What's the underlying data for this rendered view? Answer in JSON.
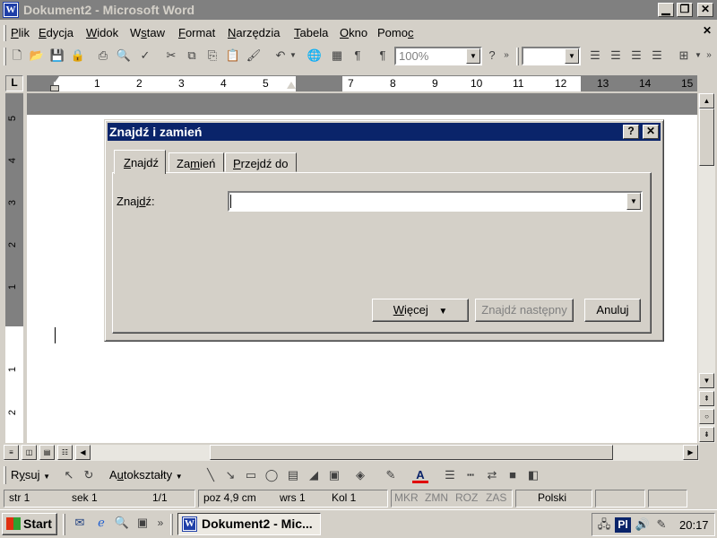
{
  "window": {
    "title": "Dokument2 - Microsoft Word",
    "app_icon_letter": "W"
  },
  "menu": {
    "items": [
      {
        "pre": "",
        "u": "P",
        "post": "lik"
      },
      {
        "pre": "",
        "u": "E",
        "post": "dycja"
      },
      {
        "pre": "",
        "u": "W",
        "post": "idok"
      },
      {
        "pre": "W",
        "u": "s",
        "post": "taw"
      },
      {
        "pre": "",
        "u": "F",
        "post": "ormat"
      },
      {
        "pre": "",
        "u": "N",
        "post": "arzędzia"
      },
      {
        "pre": "",
        "u": "T",
        "post": "abela"
      },
      {
        "pre": "",
        "u": "O",
        "post": "kno"
      },
      {
        "pre": "Pomo",
        "u": "c",
        "post": ""
      }
    ]
  },
  "toolbar": {
    "zoom": "100%"
  },
  "ruler": {
    "h_left_marks": [
      "1",
      "2",
      "3",
      "4",
      "5"
    ],
    "h_right_marks": [
      "7",
      "8",
      "9",
      "10",
      "11",
      "12",
      "13",
      "14",
      "15"
    ],
    "v_marks": [
      "5",
      "4",
      "3",
      "2",
      "1",
      "1",
      "2"
    ],
    "corner": "L"
  },
  "dialog": {
    "title": "Znajdź i zamień",
    "help": "?",
    "close": "✕",
    "tabs": [
      {
        "pre": "",
        "u": "Z",
        "post": "najdź"
      },
      {
        "pre": "Za",
        "u": "m",
        "post": "ień"
      },
      {
        "pre": "",
        "u": "P",
        "post": "rzejdź do"
      }
    ],
    "find_label_pre": "Znaj",
    "find_label_u": "d",
    "find_label_post": "ź:",
    "find_value": "",
    "more_pre": "",
    "more_u": "W",
    "more_post": "ięcej",
    "find_next": "Znajdź następny",
    "cancel": "Anuluj"
  },
  "drawing": {
    "draw_pre": "R",
    "draw_u": "y",
    "draw_post": "suj",
    "autoshapes_pre": "A",
    "autoshapes_u": "u",
    "autoshapes_post": "tokształty"
  },
  "status": {
    "page": "str 1",
    "section": "sek 1",
    "pages": "1/1",
    "position": "poz 4,9 cm",
    "line": "wrs 1",
    "column": "Kol 1",
    "mkr": "MKR",
    "zmn": "ZMN",
    "roz": "ROZ",
    "zas": "ZAS",
    "language": "Polski"
  },
  "taskbar": {
    "start": "Start",
    "task": "Dokument2 - Mic...",
    "lang": "Pl",
    "clock": "20:17"
  }
}
